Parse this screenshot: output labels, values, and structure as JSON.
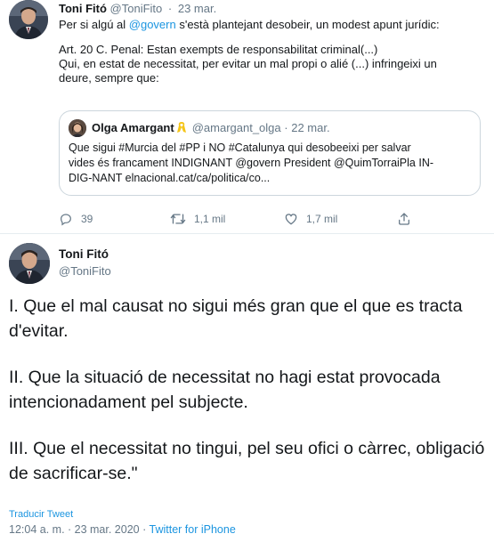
{
  "reply_tweet": {
    "author_name": "Toni Fitó",
    "author_handle": "@ToniFito",
    "separator": "·",
    "date": "23 mar.",
    "text_line1_pre": "Per si algú al ",
    "text_line1_mention": "@govern",
    "text_line1_post": " s'està plantejant desobeir, un modest apunt jurídic:",
    "text_line2": "Art. 20 C. Penal: Estan exempts de responsabilitat criminal(...)",
    "text_line3": "Qui, en estat de necessitat, per evitar un mal propi o alié (...) infringeixi un",
    "text_line4": "deure, sempre que:",
    "quoted": {
      "author_name": "Olga Amargant",
      "author_handle": "@amargant_olga",
      "separator": "·",
      "date": "22 mar.",
      "line1": "Que sigui #Murcia del #PP i NO #Catalunya qui desobeeixi per salvar",
      "line2": "vides és francament INDIGNANT @govern President @QuimTorraiPla IN-",
      "line3": "DIG-NANT elnacional.cat/ca/politica/co..."
    },
    "actions": {
      "reply_count": "39",
      "retweet_count": "1,1 mil",
      "like_count": "1,7 mil"
    }
  },
  "main_tweet": {
    "author_name": "Toni Fitó",
    "author_handle": "@ToniFito",
    "paragraph1": "I. Que el mal causat no sigui més gran que el que es tracta d'evitar.",
    "paragraph2": "II. Que la situació de necessitat no hagi estat provocada intencionadament pel subjecte.",
    "paragraph3": "III. Que el necessitat no tingui, pel seu ofici o càrrec, obligació de sacrificar-se.\"",
    "translate_link": "Traducir Tweet",
    "timestamp": "12:04 a. m. · 23 mar. 2020 · ",
    "source": "Twitter for iPhone"
  },
  "colors": {
    "link": "#1b95e0",
    "secondary_text": "#657786",
    "border": "#ccd6dd",
    "ribbon": "#f5c518"
  },
  "icons": {
    "reply": "reply-icon",
    "retweet": "retweet-icon",
    "like": "heart-icon",
    "share": "share-icon",
    "ribbon": "yellow-ribbon-icon"
  }
}
